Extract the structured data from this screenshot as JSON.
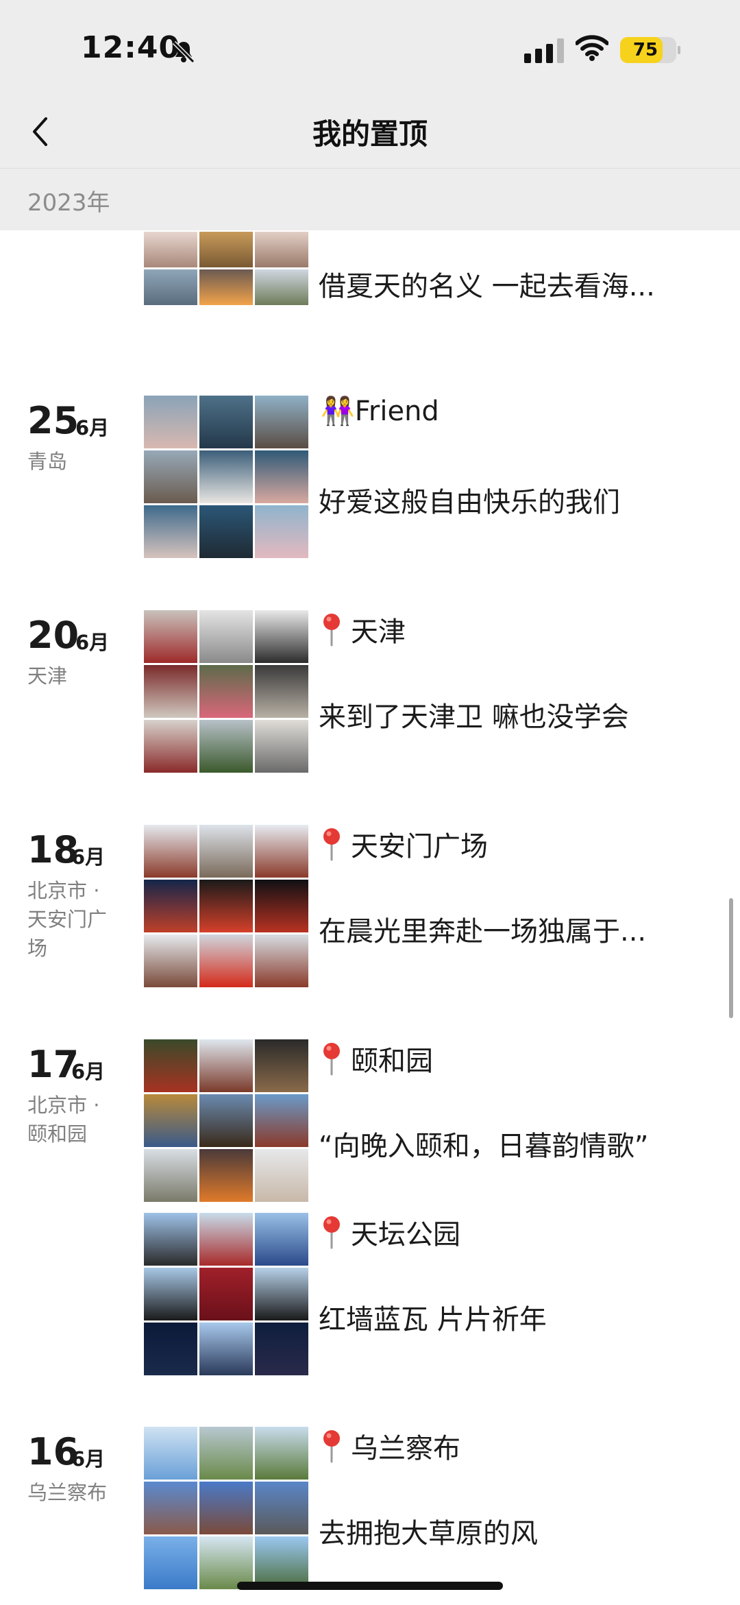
{
  "status_bar": {
    "time": "12:40",
    "battery": "75",
    "battery_level": 0.75
  },
  "nav": {
    "title": "我的置顶"
  },
  "section": {
    "year": "2023年"
  },
  "posts": [
    {
      "caption": "借夏天的名义 一起去看海..."
    },
    {
      "day": "25",
      "month": "6月",
      "place": "青岛",
      "location": "👭Friend",
      "caption": "好爱这般自由快乐的我们"
    },
    {
      "day": "20",
      "month": "6月",
      "place": "天津",
      "location": "天津",
      "caption": "来到了天津卫 嘛也没学会"
    },
    {
      "day": "18",
      "month": "6月",
      "place": "北京市 · 天安门广场",
      "location": "天安门广场",
      "caption": "在晨光里奔赴一场独属于..."
    },
    {
      "day": "17",
      "month": "6月",
      "place": "北京市 · 颐和园",
      "location": "颐和园",
      "caption": "“向晚入颐和，日暮韵情歌”"
    },
    {
      "location": "天坛公园",
      "caption": "红墙蓝瓦 片片祈年"
    },
    {
      "day": "16",
      "month": "6月",
      "place": "乌兰察布",
      "location": "乌兰察布",
      "caption": "去拥抱大草原的风"
    }
  ],
  "colors": {
    "bar_bg": "#ededed",
    "battery_fill": "#f7d21c",
    "pin_red": "#e53935",
    "muted_text": "#7f7f7f"
  }
}
